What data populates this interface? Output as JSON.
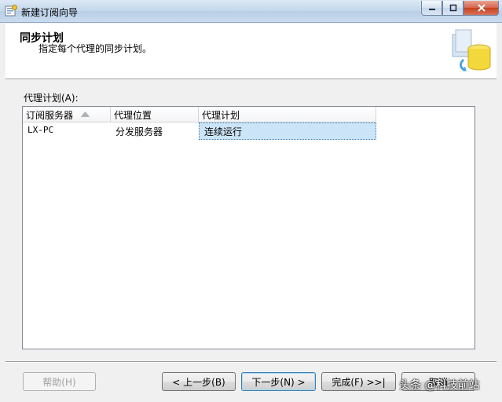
{
  "window": {
    "title": "新建订阅向导"
  },
  "header": {
    "title": "同步计划",
    "subtitle": "指定每个代理的同步计划。"
  },
  "list": {
    "label": "代理计划(A):",
    "columns": [
      "订阅服务器",
      "代理位置",
      "代理计划"
    ],
    "rows": [
      {
        "subscriber": "LX-PC",
        "location": "分发服务器",
        "schedule": "连续运行"
      }
    ]
  },
  "buttons": {
    "help": "帮助(H)",
    "back": "< 上一步(B)",
    "next": "下一步(N) >",
    "finish": "完成(F) >>|",
    "cancel": "取消"
  },
  "watermark": "头条 @科技前站"
}
